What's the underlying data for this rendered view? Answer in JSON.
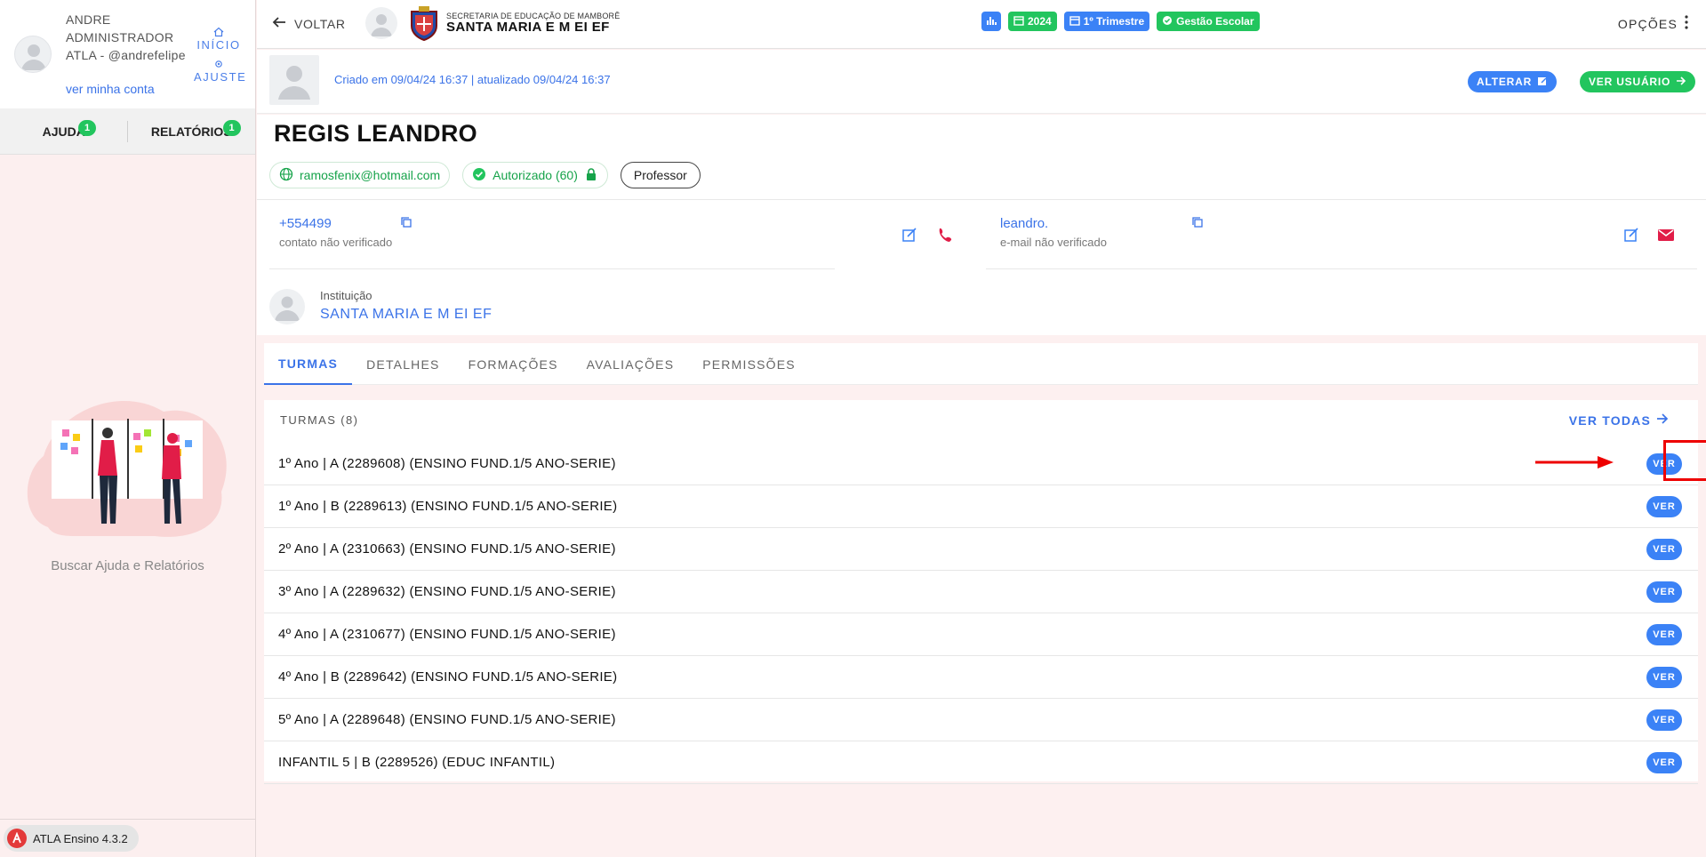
{
  "sidebar": {
    "user_name": "ANDRE ADMINISTRADOR ATLA - @andrefelipe",
    "account_link": "ver minha conta",
    "quick": [
      {
        "label": "INÍCIO"
      },
      {
        "label": "AJUSTE"
      }
    ],
    "tabs": [
      {
        "label": "AJUDA",
        "badge": "1"
      },
      {
        "label": "RELATÓRIOS",
        "badge": "1"
      }
    ],
    "help_text": "Buscar Ajuda e Relatórios",
    "version": "ATLA Ensino 4.3.2"
  },
  "topbar": {
    "back_label": "VOLTAR",
    "school_sub": "SECRETARIA DE EDUCAÇÃO DE MAMBORÊ",
    "school_name": "SANTA MARIA E M EI EF",
    "chips": [
      {
        "label": "",
        "icon": "bar-chart-icon",
        "color": "#3b82f6"
      },
      {
        "label": "2024",
        "icon": "calendar-icon",
        "color": "#22c55e"
      },
      {
        "label": "1º Trimestre",
        "icon": "calendar-icon",
        "color": "#3b82f6"
      },
      {
        "label": "Gestão Escolar",
        "icon": "check-circle-icon",
        "color": "#22c55e"
      }
    ],
    "options_label": "OPÇÕES"
  },
  "header": {
    "created_text": "Criado em 09/04/24 16:37 | atualizado 09/04/24 16:37",
    "alterar_label": "ALTERAR",
    "ver_usuario_label": "VER USUÁRIO"
  },
  "profile": {
    "name": "REGIS LEANDRO",
    "email_tag": "ramosfenix@hotmail.com",
    "auth_tag": "Autorizado (60)",
    "role_tag": "Professor",
    "phone_value": "+554499",
    "phone_status": "contato não verificado",
    "email_value": "leandro.",
    "email_status": "e-mail não verificado",
    "institution_label": "Instituição",
    "institution_value": "SANTA MARIA E M EI EF"
  },
  "tabs": [
    {
      "label": "TURMAS",
      "active": true
    },
    {
      "label": "DETALHES",
      "active": false
    },
    {
      "label": "FORMAÇÕES",
      "active": false
    },
    {
      "label": "AVALIAÇÕES",
      "active": false
    },
    {
      "label": "PERMISSÕES",
      "active": false
    }
  ],
  "turmas": {
    "title": "TURMAS (8)",
    "ver_todas_label": "VER TODAS",
    "button_label": "VER",
    "rows": [
      "1º Ano | A (2289608) (ENSINO FUND.1/5 ANO-SERIE)",
      "1º Ano | B (2289613) (ENSINO FUND.1/5 ANO-SERIE)",
      "2º Ano | A (2310663) (ENSINO FUND.1/5 ANO-SERIE)",
      "3º Ano | A (2289632) (ENSINO FUND.1/5 ANO-SERIE)",
      "4º Ano | A (2310677) (ENSINO FUND.1/5 ANO-SERIE)",
      "4º Ano | B (2289642) (ENSINO FUND.1/5 ANO-SERIE)",
      "5º Ano | A (2289648) (ENSINO FUND.1/5 ANO-SERIE)",
      "INFANTIL 5 | B (2289526) (EDUC INFANTIL)"
    ]
  }
}
